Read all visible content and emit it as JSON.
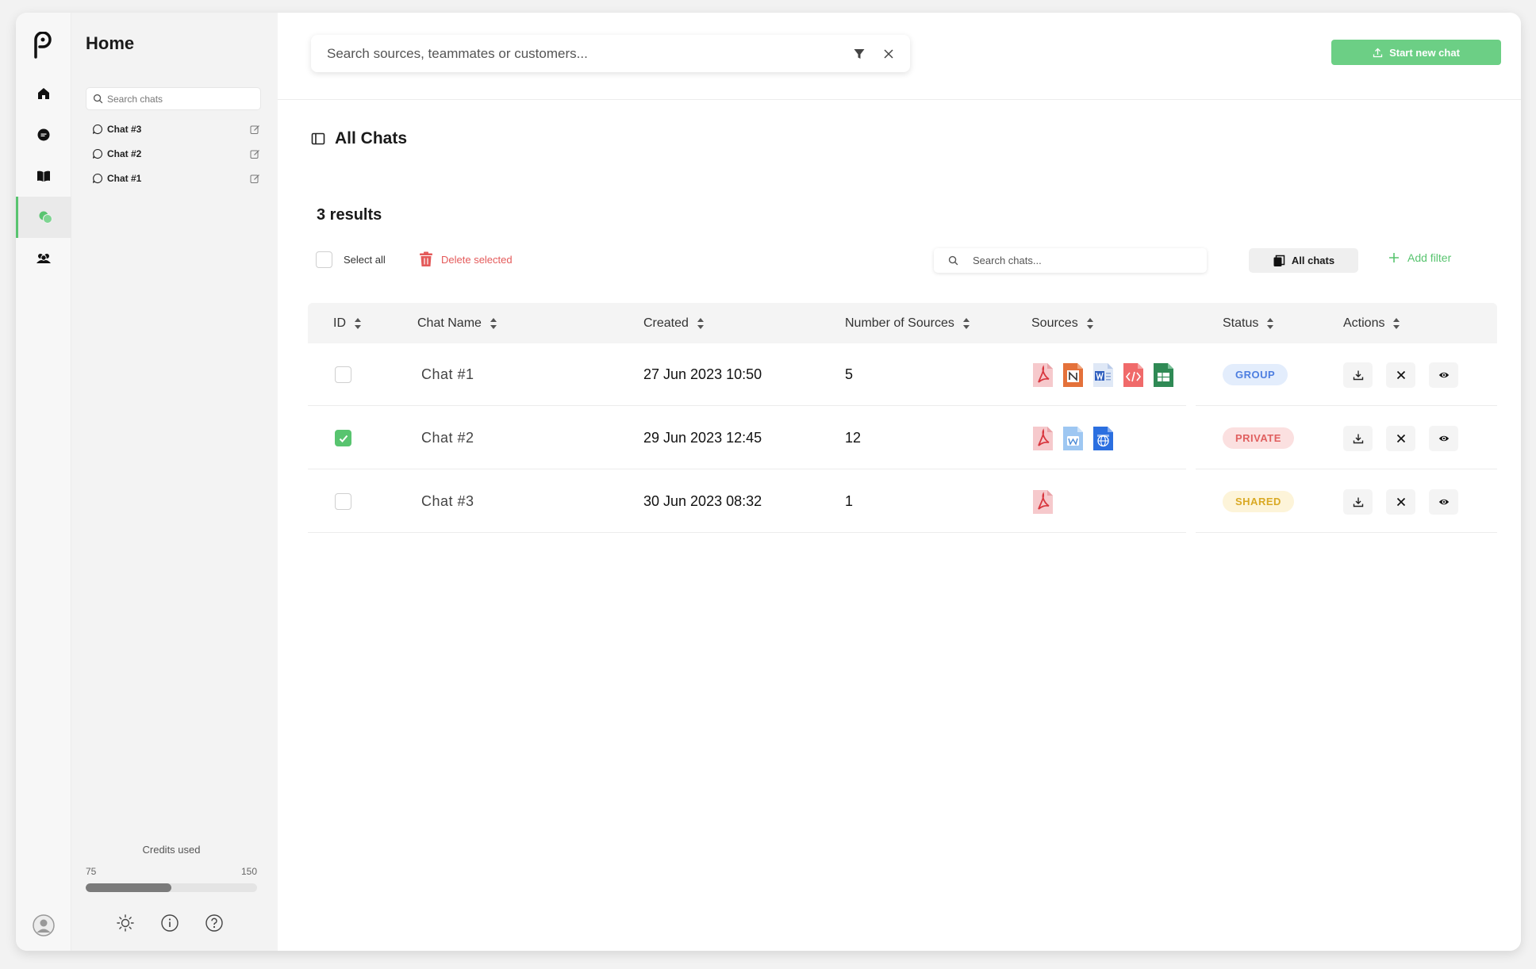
{
  "rail": {
    "items": [
      {
        "name": "home-icon",
        "active": false
      },
      {
        "name": "chat-icon",
        "active": false
      },
      {
        "name": "book-icon",
        "active": false
      },
      {
        "name": "chats-icon",
        "active": true
      },
      {
        "name": "team-icon",
        "active": false
      }
    ]
  },
  "sidebar": {
    "title": "Home",
    "search_placeholder": "Search chats",
    "chats": [
      {
        "label": "Chat #3"
      },
      {
        "label": "Chat #2"
      },
      {
        "label": "Chat #1"
      }
    ],
    "credits": {
      "label": "Credits used",
      "used": "75",
      "total": "150",
      "fraction": 0.5
    }
  },
  "topbar": {
    "search_placeholder": "Search sources, teammates or customers...",
    "new_chat_label": "Start new chat"
  },
  "page": {
    "title": "All Chats",
    "results": "3 results",
    "select_all": "Select all",
    "delete_selected": "Delete selected",
    "search_placeholder": "Search chats...",
    "all_chats": "All chats",
    "add_filter": "Add filter"
  },
  "table": {
    "columns": [
      "ID",
      "Chat Name",
      "Created",
      "Number of Sources",
      "Sources",
      "Status",
      "Actions"
    ],
    "rows": [
      {
        "checked": false,
        "name": "Chat #1",
        "created": "27 Jun 2023 10:50",
        "sources_count": "5",
        "sources": [
          "pdf",
          "notion",
          "word",
          "html",
          "sheets"
        ],
        "status": "GROUP",
        "status_kind": "group"
      },
      {
        "checked": true,
        "name": "Chat #2",
        "created": "29 Jun 2023 12:45",
        "sources_count": "12",
        "sources": [
          "pdf",
          "word-light",
          "web"
        ],
        "status": "PRIVATE",
        "status_kind": "private"
      },
      {
        "checked": false,
        "name": "Chat #3",
        "created": "30 Jun 2023 08:32",
        "sources_count": "1",
        "sources": [
          "pdf"
        ],
        "status": "SHARED",
        "status_kind": "shared"
      }
    ]
  },
  "colors": {
    "accent": "#58c46f",
    "danger": "#e45a5a"
  }
}
